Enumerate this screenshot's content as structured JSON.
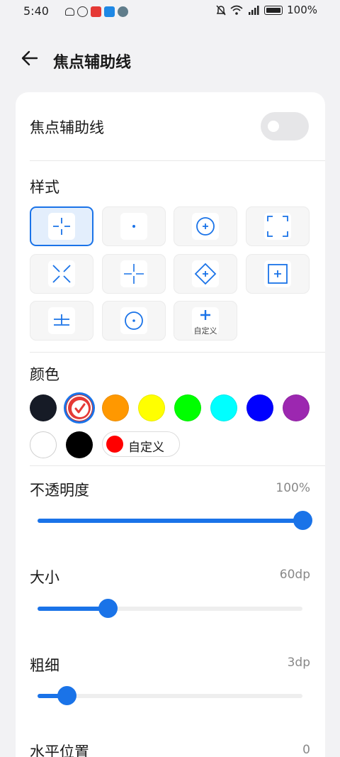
{
  "status_bar": {
    "time": "5:40",
    "battery": "100%",
    "icons": [
      "mute-icon",
      "wifi-icon",
      "signal-icon",
      "battery-icon"
    ]
  },
  "header": {
    "title": "焦点辅助线"
  },
  "toggle_row": {
    "label": "焦点辅助线",
    "enabled": false
  },
  "style_section": {
    "label": "样式",
    "options": [
      {
        "icon": "crosshair-gap-icon",
        "selected": true
      },
      {
        "icon": "center-dot-icon",
        "selected": false
      },
      {
        "icon": "circle-plus-icon",
        "selected": false
      },
      {
        "icon": "corner-brackets-icon",
        "selected": false
      },
      {
        "icon": "x-cross-icon",
        "selected": false
      },
      {
        "icon": "thin-cross-icon",
        "selected": false
      },
      {
        "icon": "diamond-plus-icon",
        "selected": false
      },
      {
        "icon": "square-plus-icon",
        "selected": false
      },
      {
        "icon": "horizontal-lines-icon",
        "selected": false
      },
      {
        "icon": "circle-dot-icon",
        "selected": false
      },
      {
        "icon": "plus-icon",
        "selected": false,
        "label": "自定义"
      }
    ]
  },
  "color_section": {
    "label": "颜色",
    "swatches": [
      "#161b26",
      "#e53935",
      "#ff9800",
      "#ffff00",
      "#00ff00",
      "#00ffff",
      "#0000ff",
      "#9c27b0",
      "#ffffff",
      "#000000"
    ],
    "selected_index": 1,
    "custom": {
      "label": "自定义",
      "color": "#ff0000"
    }
  },
  "sliders": [
    {
      "label": "不透明度",
      "value_text": "100%",
      "fraction": 1.0
    },
    {
      "label": "大小",
      "value_text": "60dp",
      "fraction": 0.265
    },
    {
      "label": "粗细",
      "value_text": "3dp",
      "fraction": 0.11
    },
    {
      "label": "水平位置",
      "value_text": "0"
    }
  ],
  "colors": {
    "accent": "#1a73e8",
    "background": "#f2f2f4",
    "card": "#ffffff"
  }
}
